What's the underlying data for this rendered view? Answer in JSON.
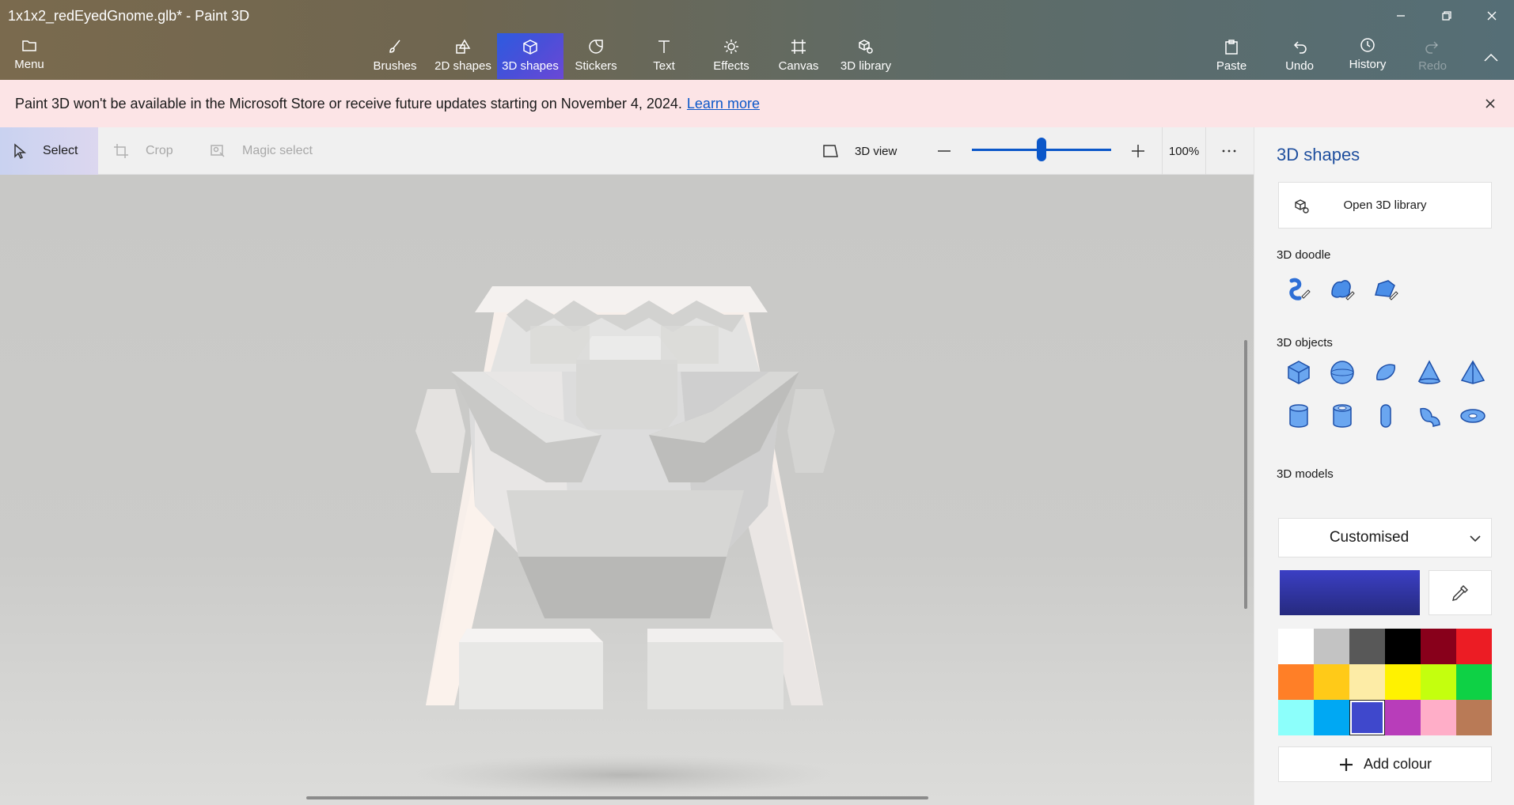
{
  "window": {
    "title": "1x1x2_redEyedGnome.glb* - Paint 3D"
  },
  "ribbon": {
    "menu": "Menu",
    "tools": [
      {
        "id": "brushes",
        "label": "Brushes",
        "icon": "brush-icon"
      },
      {
        "id": "2d-shapes",
        "label": "2D shapes",
        "icon": "2d-shapes-icon"
      },
      {
        "id": "3d-shapes",
        "label": "3D shapes",
        "icon": "3d-shapes-icon",
        "active": true
      },
      {
        "id": "stickers",
        "label": "Stickers",
        "icon": "sticker-icon"
      },
      {
        "id": "text",
        "label": "Text",
        "icon": "text-icon"
      },
      {
        "id": "effects",
        "label": "Effects",
        "icon": "effects-icon"
      },
      {
        "id": "canvas",
        "label": "Canvas",
        "icon": "canvas-icon"
      },
      {
        "id": "3d-library",
        "label": "3D library",
        "icon": "3d-library-icon"
      }
    ],
    "paste": "Paste",
    "undo": "Undo",
    "history": "History",
    "redo": "Redo"
  },
  "banner": {
    "text": "Paint 3D won't be available in the Microsoft Store or receive future updates starting on November 4, 2024.",
    "link": "Learn more"
  },
  "toolbar": {
    "select": "Select",
    "crop": "Crop",
    "magic_select": "Magic select",
    "view_3d": "3D view",
    "zoom": "100%",
    "zoom_slider_fraction": 0.5
  },
  "panel": {
    "title": "3D shapes",
    "open_library": "Open 3D library",
    "doodle_label": "3D doodle",
    "objects_label": "3D objects",
    "models_label": "3D models",
    "texture_mode": "Customised",
    "current_color": "#3b3fc4",
    "add_colour": "Add colour",
    "palette": [
      "#ffffff",
      "#c3c3c3",
      "#585858",
      "#000000",
      "#88001b",
      "#ec1c24",
      "#ff7f27",
      "#ffca18",
      "#fdeca6",
      "#fff200",
      "#c4ff0e",
      "#0ed145",
      "#8cfffb",
      "#00a8f3",
      "#3f48cc",
      "#b83dba",
      "#ffaec8",
      "#b97a56"
    ]
  }
}
